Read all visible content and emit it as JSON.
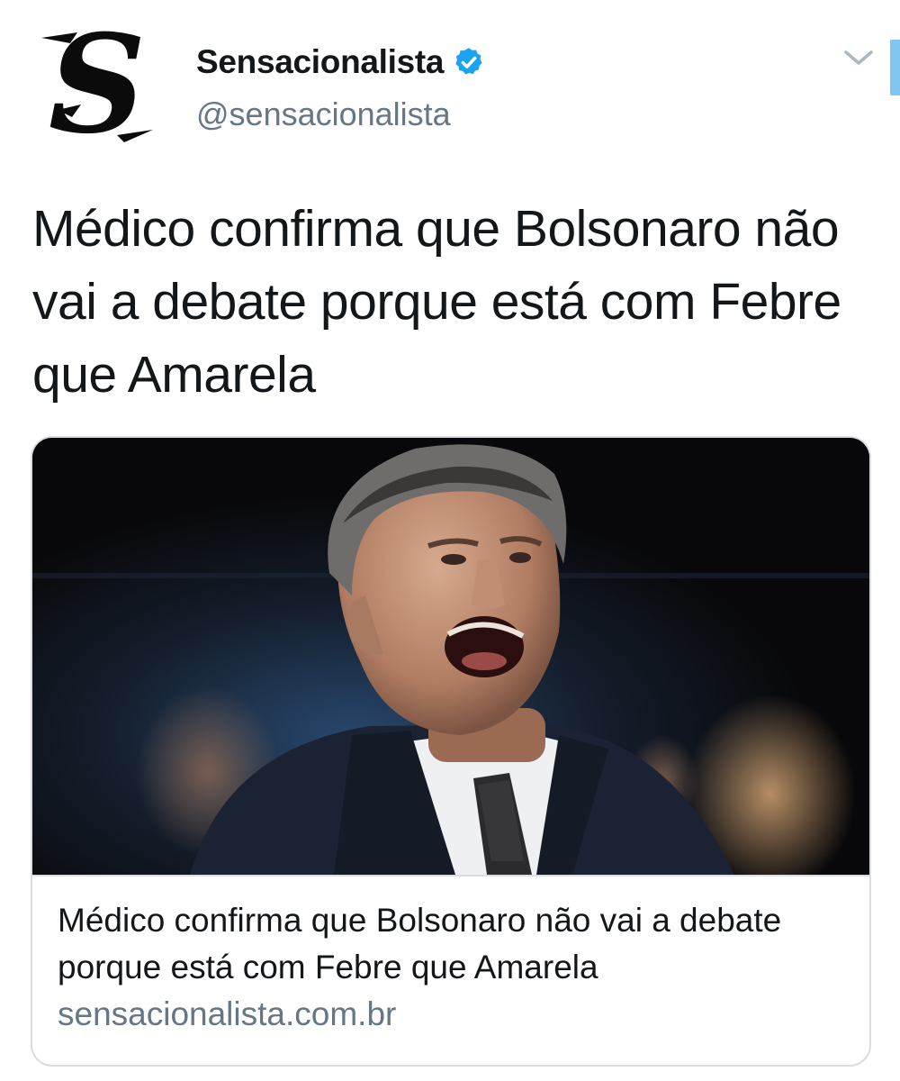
{
  "account": {
    "display_name": "Sensacionalista",
    "handle": "@sensacionalista",
    "verified": true,
    "avatar_icon": "gothic-s-logo",
    "avatar_letter": "S"
  },
  "tweet": {
    "text": "Médico confirma que Bolsonaro não vai a debate porque está com Febre que Amarela"
  },
  "card": {
    "title": "Médico confirma que Bolsonaro não vai a debate porque está com Febre que Amarela",
    "domain": "sensacionalista.com.br",
    "image_icon": "article-photo"
  },
  "icons": {
    "verified": "verified-badge-icon",
    "menu": "chevron-down-icon"
  },
  "colors": {
    "text_primary": "#14171a",
    "text_secondary": "#657786",
    "verified_blue": "#1da1f2",
    "border": "#d9dee3"
  }
}
